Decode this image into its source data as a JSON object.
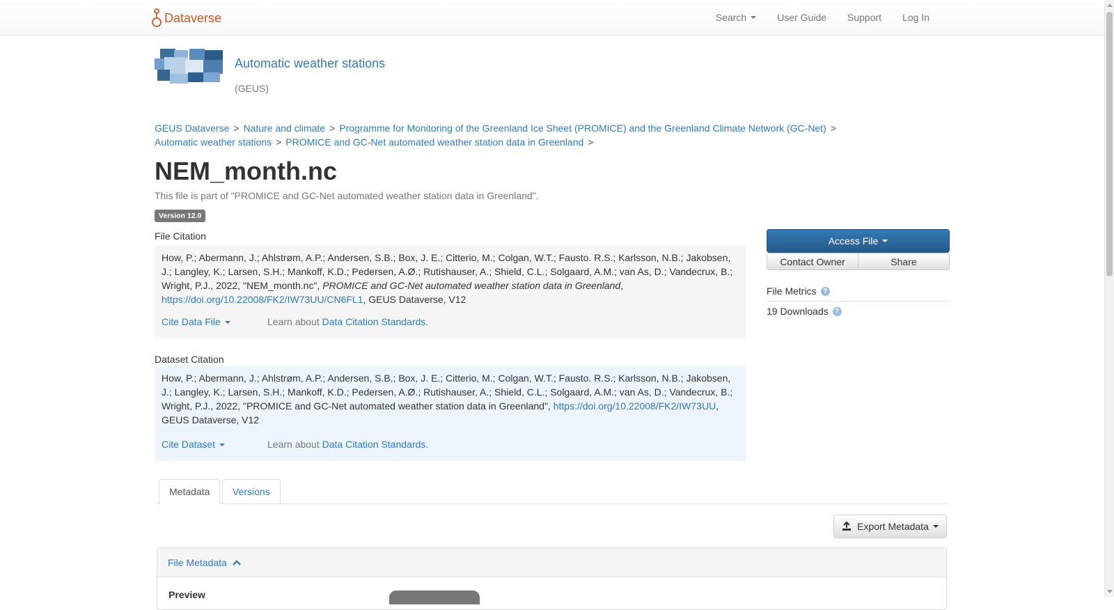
{
  "navbar": {
    "brand": "Dataverse",
    "links": {
      "search": "Search",
      "user_guide": "User Guide",
      "support": "Support",
      "login": "Log In"
    }
  },
  "dataverse": {
    "name": "Automatic weather stations",
    "affiliation": "(GEUS)"
  },
  "breadcrumb": [
    "GEUS Dataverse",
    "Nature and climate",
    "Programme for Monitoring of the Greenland Ice Sheet (PROMICE) and the Greenland Climate Network (GC-Net)",
    "Automatic weather stations",
    "PROMICE and GC-Net automated weather station data in Greenland"
  ],
  "breadcrumb_separator": ">",
  "file": {
    "title": "NEM_month.nc",
    "part_of": "This file is part of \"PROMICE and GC-Net automated weather station data in Greenland\".",
    "version": "Version 12.0"
  },
  "file_citation": {
    "label": "File Citation",
    "text_before": "How, P.; Abermann, J.; Ahlstrøm, A.P.; Andersen, S.B.; Box, J. E.; Citterio, M.; Colgan, W.T.; Fausto. R.S.; Karlsson, N.B.; Jakobsen, J.; Langley, K.; Larsen, S.H.; Mankoff, K.D.; Pedersen, A.Ø.; Rutishauser, A.; Shield, C.L.; Solgaard, A.M.; van As, D.; Vandecrux, B.; Wright, P.J., 2022, \"NEM_month.nc\", ",
    "italic": "PROMICE and GC-Net automated weather station data in Greenland",
    "comma": ",",
    "doi": "https://doi.org/10.22008/FK2/IW73UU/CN6FL1",
    "text_after": ", GEUS Dataverse, V12",
    "cite_button": "Cite Data File",
    "learn_prefix": "Learn about ",
    "learn_link": "Data Citation Standards."
  },
  "dataset_citation": {
    "label": "Dataset Citation",
    "text_before": "How, P.; Abermann, J.; Ahlstrøm, A.P.; Andersen, S.B.; Box, J. E.; Citterio, M.; Colgan, W.T.; Fausto. R.S.; Karlsson, N.B.; Jakobsen, J.; Langley, K.; Larsen, S.H.; Mankoff, K.D.; Pedersen, A.Ø.; Rutishauser, A.; Shield, C.L.; Solgaard, A.M.; van As, D.; Vandecrux, B.; Wright, P.J., 2022, \"PROMICE and GC-Net automated weather station data in Greenland\", ",
    "doi": "https://doi.org/10.22008/FK2/IW73UU",
    "text_after": ", GEUS Dataverse, V12",
    "cite_button": "Cite Dataset",
    "learn_prefix": "Learn about ",
    "learn_link": "Data Citation Standards."
  },
  "actions": {
    "access_file": "Access File",
    "contact_owner": "Contact Owner",
    "share": "Share"
  },
  "metrics": {
    "title": "File Metrics",
    "downloads": "19 Downloads",
    "help_glyph": "?"
  },
  "tabs": [
    {
      "label": "Metadata",
      "active": true
    },
    {
      "label": "Versions",
      "active": false
    }
  ],
  "export_metadata": "Export Metadata",
  "file_metadata": {
    "heading": "File Metadata",
    "preview_label": "Preview"
  },
  "colors": {
    "brand": "#c55b28",
    "link": "#337ab7",
    "primary_button": "#337ab7",
    "file_citation_bg": "#f5f5f5",
    "dataset_citation_bg": "#edf4fb"
  },
  "icons": {
    "brand": "dataverse-logo-icon",
    "export": "export-icon",
    "collapse": "chevron-up-icon",
    "help": "question-circle-icon"
  }
}
